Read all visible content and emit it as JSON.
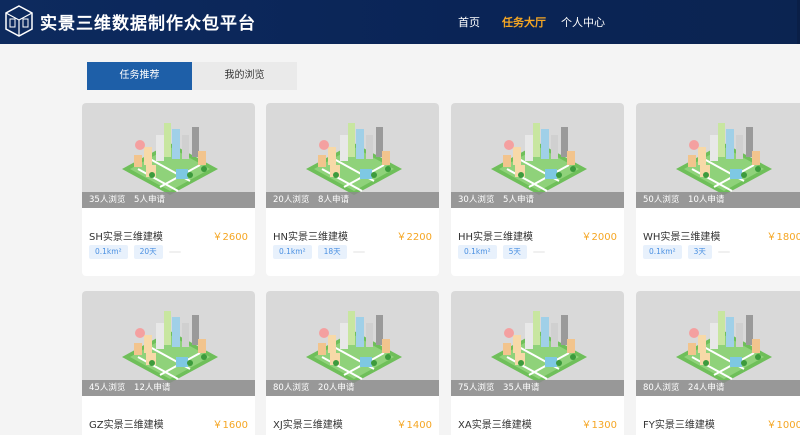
{
  "header": {
    "title": "实景三维数据制作众包平台",
    "nav": [
      {
        "label": "首页"
      },
      {
        "label": "任务大厅"
      },
      {
        "label": "个人中心"
      }
    ]
  },
  "tabs": [
    {
      "label": "任务推荐"
    },
    {
      "label": "我的浏览"
    }
  ],
  "cards": [
    {
      "stats_views": "35人浏览",
      "stats_apply": "5人申请",
      "name": "SH实景三维建模",
      "price": "￥2600",
      "area": "0.1km²",
      "days": "20天"
    },
    {
      "stats_views": "20人浏览",
      "stats_apply": "8人申请",
      "name": "HN实景三维建模",
      "price": "￥2200",
      "area": "0.1km²",
      "days": "18天"
    },
    {
      "stats_views": "30人浏览",
      "stats_apply": "5人申请",
      "name": "HH实景三维建模",
      "price": "￥2000",
      "area": "0.1km²",
      "days": "5天"
    },
    {
      "stats_views": "50人浏览",
      "stats_apply": "10人申请",
      "name": "WH实景三维建模",
      "price": "￥1800",
      "area": "0.1km²",
      "days": "3天"
    },
    {
      "stats_views": "45人浏览",
      "stats_apply": "12人申请",
      "name": "GZ实景三维建模",
      "price": "￥1600"
    },
    {
      "stats_views": "80人浏览",
      "stats_apply": "20人申请",
      "name": "XJ实景三维建模",
      "price": "￥1400"
    },
    {
      "stats_views": "75人浏览",
      "stats_apply": "35人申请",
      "name": "XA实景三维建模",
      "price": "￥1300"
    },
    {
      "stats_views": "80人浏览",
      "stats_apply": "24人申请",
      "name": "FY实景三维建模",
      "price": "￥1000"
    }
  ]
}
